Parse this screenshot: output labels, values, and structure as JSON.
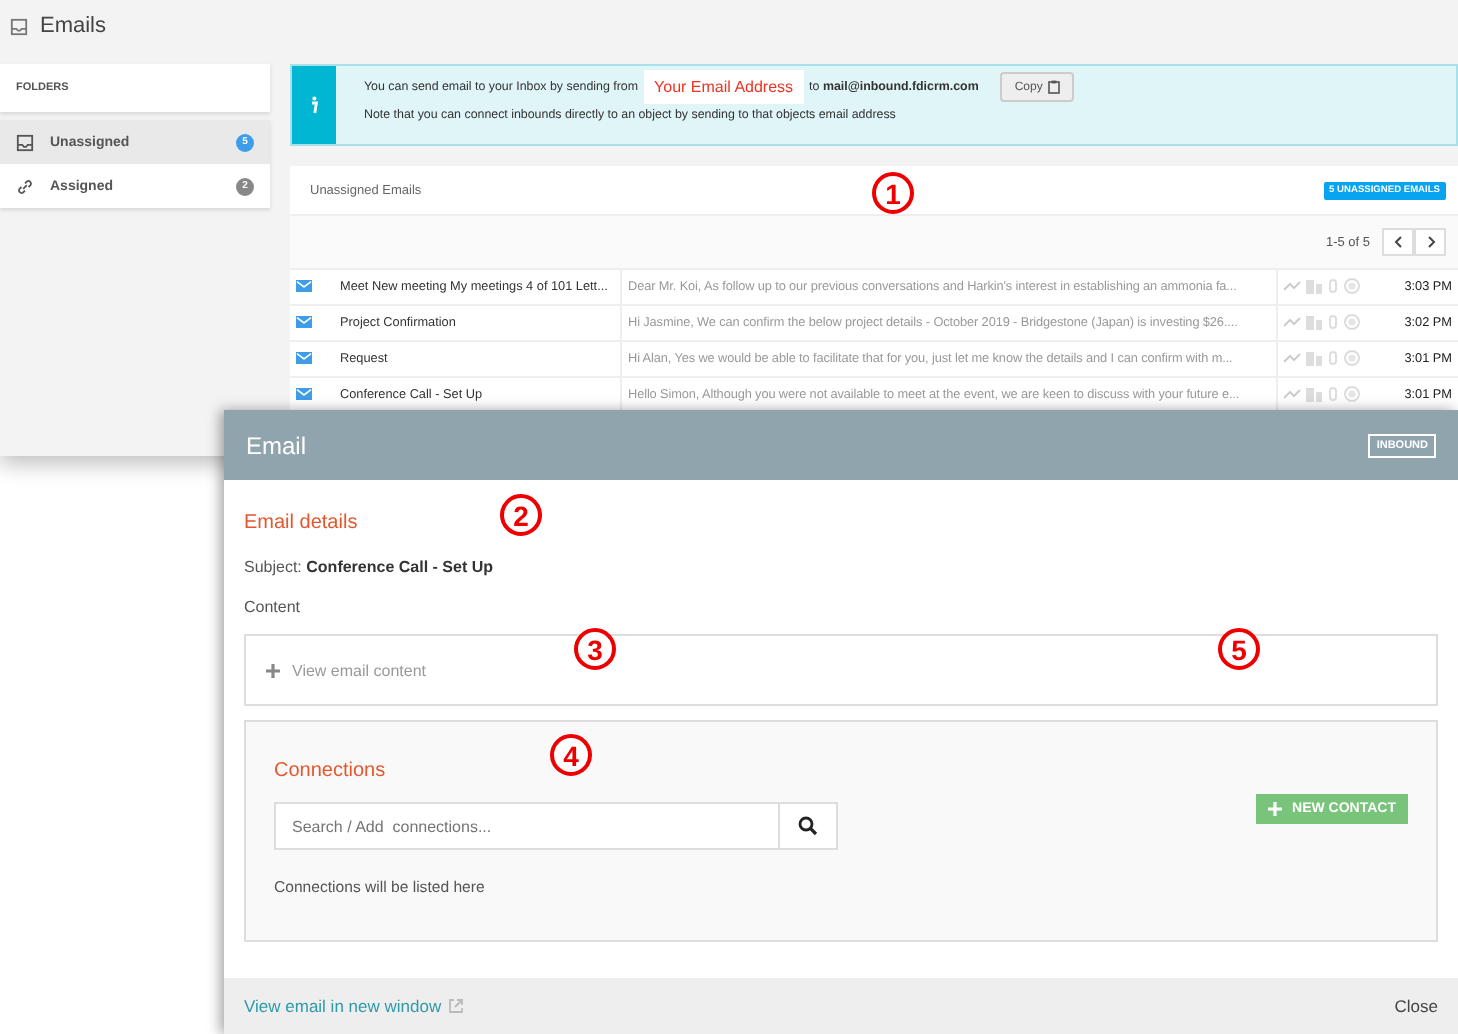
{
  "page": {
    "title": "Emails"
  },
  "sidebar": {
    "heading": "FOLDERS",
    "items": [
      {
        "kind": "inbox",
        "label": "Unassigned",
        "count": "5",
        "selected": true
      },
      {
        "kind": "link",
        "label": "Assigned",
        "count": "2",
        "selected": false
      }
    ]
  },
  "info_banner": {
    "text_before": "You can send email to your Inbox by sending from",
    "address_label": "Your Email Address",
    "text_after": "to **mail@inbound.fdicrm.com**",
    "copy_button": "Copy",
    "note": "Note that you can connect inbounds directly to an object by sending to that objects email address"
  },
  "email_list": {
    "title": "Unassigned Emails",
    "badge": "5 UNASSIGNED EMAILS",
    "pagination": "1-5 of 5",
    "rows": [
      {
        "subject": "Meet New meeting My meetings 4 of 101 Lett...",
        "preview": "Dear Mr. Koi, As follow up to our previous conversations and Harkin's interest in establishing an ammonia fa...",
        "time": "3:03 PM"
      },
      {
        "subject": "Project Confirmation",
        "preview": "Hi Jasmine, We can confirm the below project details - October 2019 - Bridgestone (Japan) is investing $26....",
        "time": "3:02 PM"
      },
      {
        "subject": "Request",
        "preview": "Hi Alan, Yes we would be able to facilitate that for you, just let me know the details and I can confirm with m...",
        "time": "3:01 PM"
      },
      {
        "subject": "Conference Call - Set Up",
        "preview": "Hello Simon, Although you were not available to meet at the event, we are keen to discuss with your future e...",
        "time": "3:01 PM"
      }
    ]
  },
  "modal": {
    "title": "Email",
    "tag": "INBOUND",
    "section_title": "Email details",
    "subject": "Subject: **Conference Call - Set Up**",
    "content_label": "Content",
    "content_toggle": {
      "label": "View email content",
      "expanded": false
    },
    "connections": {
      "title": "Connections",
      "search_placeholder": "Search / Add  connections...",
      "new_contact_button": "NEW CONTACT",
      "empty_text": "Connections will be listed here"
    },
    "footer": {
      "link": "View email in new window",
      "close_button": "Close"
    }
  },
  "annotations": [
    "1",
    "2",
    "3",
    "4",
    "5"
  ]
}
